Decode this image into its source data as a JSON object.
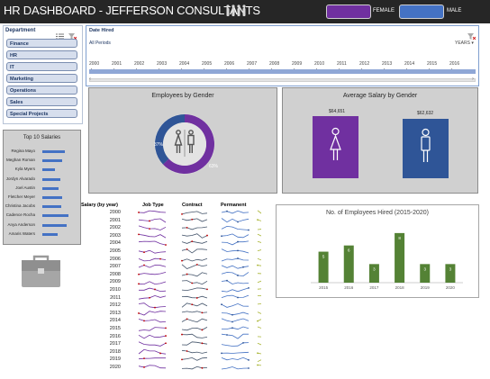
{
  "header": {
    "title": "HR DASHBOARD - JEFFERSON CONSULTANTS",
    "legend": [
      {
        "label": "FEMALE",
        "color": "#7030a0"
      },
      {
        "label": "MALE",
        "color": "#4472c4"
      }
    ],
    "icons": [
      "people-group-icon"
    ]
  },
  "slicer": {
    "title": "Department",
    "items": [
      "Finance",
      "HR",
      "IT",
      "Marketing",
      "Operations",
      "Sales",
      "Special Projects"
    ]
  },
  "timeline": {
    "title": "Date Hired",
    "period_label": "All Periods",
    "unit_label": "YEARS",
    "years": [
      "2000",
      "2001",
      "2002",
      "2003",
      "2004",
      "2005",
      "2006",
      "2007",
      "2008",
      "2009",
      "2010",
      "2011",
      "2012",
      "2013",
      "2014",
      "2015",
      "2016"
    ]
  },
  "employees_by_gender": {
    "title": "Employees by Gender",
    "male_label": "37%",
    "female_label": "63%",
    "male_pct": 37,
    "female_pct": 63
  },
  "avg_salary": {
    "title": "Average Salary by Gender",
    "female_value": "$64,651",
    "male_value": "$62,632"
  },
  "top_salaries": {
    "title": "Top 10 Salaries",
    "names": [
      "Regina Mayo",
      "Meghan Roman",
      "Kyla Myers",
      "Jordyn Alvarado",
      "Joel Austin",
      "Fletcher Meyer",
      "Christina Jacobs",
      "Cadence Rocha",
      "Anya Anderson",
      "Amaris Waters"
    ],
    "levels": [
      0.62,
      0.55,
      0.36,
      0.5,
      0.45,
      0.55,
      0.52,
      0.72,
      0.68,
      0.42
    ]
  },
  "sparklines": {
    "headers": [
      "Salary (by year)",
      "Job Type",
      "Contract",
      "Permanent"
    ],
    "years": [
      "2000",
      "2001",
      "2002",
      "2003",
      "2004",
      "2005",
      "2006",
      "2007",
      "2008",
      "2009",
      "2010",
      "2011",
      "2012",
      "2013",
      "2014",
      "2015",
      "2016",
      "2017",
      "2018",
      "2019",
      "2020"
    ]
  },
  "chart_data": {
    "type": "bar",
    "title": "No. of Employees Hired (2015-2020)",
    "categories": [
      "2015",
      "2016",
      "2017",
      "2018",
      "2019",
      "2020"
    ],
    "values": [
      5,
      6,
      3,
      8,
      3,
      3
    ],
    "ylim": [
      0,
      9
    ],
    "color": "#548235"
  }
}
